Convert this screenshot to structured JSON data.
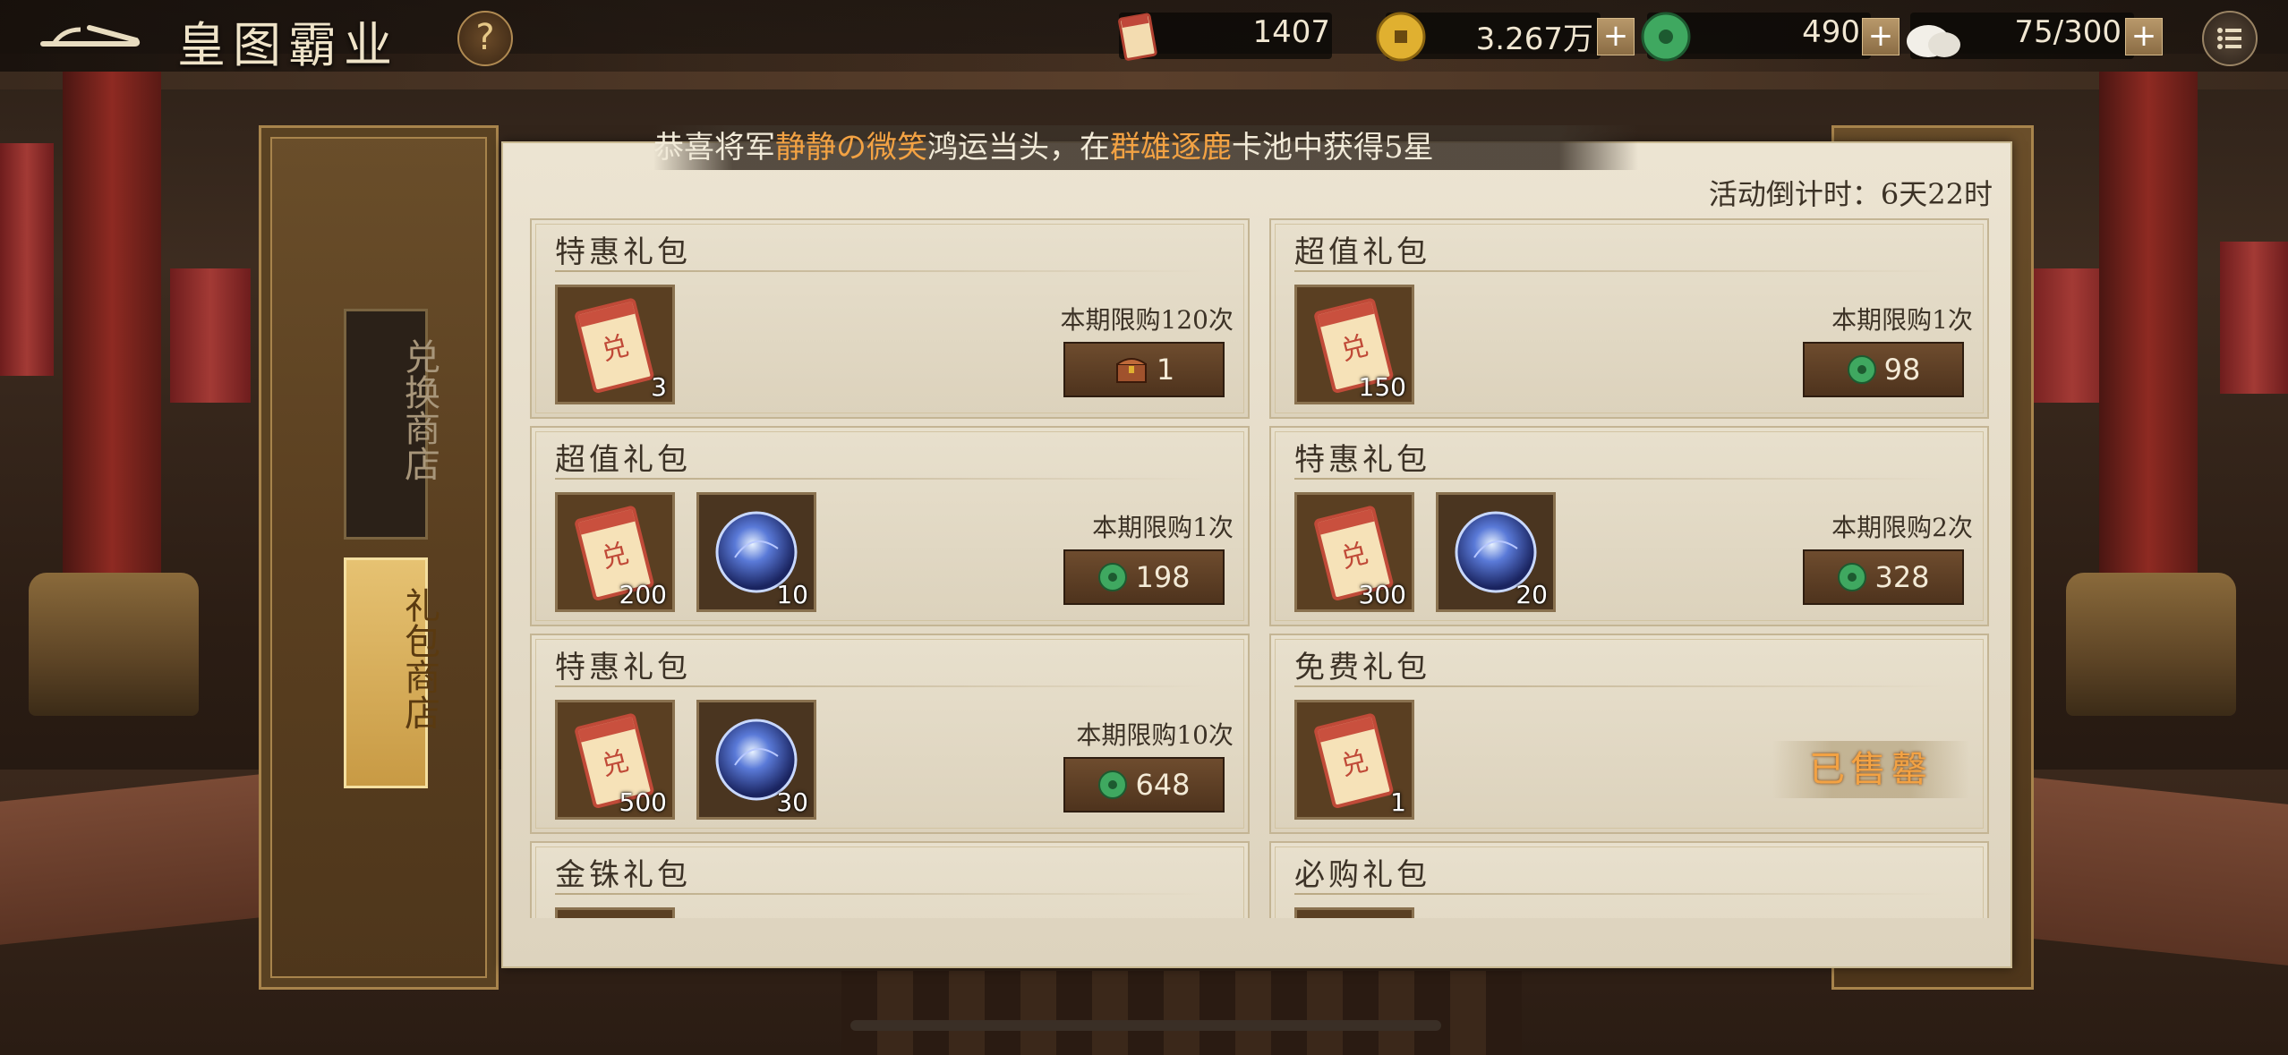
{
  "header": {
    "title": "皇图霸业",
    "help_label": "?"
  },
  "resources": {
    "tickets": "1407",
    "gold": "3.267万",
    "jade": "490",
    "stamina": "75/300",
    "plus_label": "+"
  },
  "tabs": [
    {
      "label": "兑换商店",
      "active": false
    },
    {
      "label": "礼包商店",
      "active": true
    }
  ],
  "marquee": {
    "prefix": "恭喜将军",
    "player": "静静の微笑",
    "middle": "鸿运当头，在",
    "pool": "群雄逐鹿",
    "suffix": "卡池中获得5星"
  },
  "countdown": "活动倒计时：6天22时",
  "packs": [
    {
      "title": "特惠礼包",
      "items": [
        {
          "icon": "exchange-ticket-icon",
          "count": "3"
        }
      ],
      "limit": "本期限购120次",
      "price_icon": "treasure-chest-icon",
      "price": "1"
    },
    {
      "title": "超值礼包",
      "items": [
        {
          "icon": "exchange-ticket-icon",
          "count": "150"
        }
      ],
      "limit": "本期限购1次",
      "price_icon": "jade-coin-icon",
      "price": "98"
    },
    {
      "title": "超值礼包",
      "items": [
        {
          "icon": "exchange-ticket-icon",
          "count": "200"
        },
        {
          "icon": "blue-orb-icon",
          "count": "10"
        }
      ],
      "limit": "本期限购1次",
      "price_icon": "jade-coin-icon",
      "price": "198"
    },
    {
      "title": "特惠礼包",
      "items": [
        {
          "icon": "exchange-ticket-icon",
          "count": "300"
        },
        {
          "icon": "blue-orb-icon",
          "count": "20"
        }
      ],
      "limit": "本期限购2次",
      "price_icon": "jade-coin-icon",
      "price": "328"
    },
    {
      "title": "特惠礼包",
      "items": [
        {
          "icon": "exchange-ticket-icon",
          "count": "500"
        },
        {
          "icon": "blue-orb-icon",
          "count": "30"
        }
      ],
      "limit": "本期限购10次",
      "price_icon": "jade-coin-icon",
      "price": "648"
    },
    {
      "title": "免费礼包",
      "items": [
        {
          "icon": "exchange-ticket-icon",
          "count": "1"
        }
      ],
      "status": "已售罄"
    },
    {
      "title": "金铢礼包",
      "items": [
        {
          "icon": "exchange-ticket-icon",
          "count": ""
        }
      ]
    },
    {
      "title": "必购礼包",
      "items": [
        {
          "icon": "exchange-ticket-icon",
          "count": ""
        }
      ]
    }
  ],
  "colors": {
    "accent_orange": "#f3a243",
    "panel_bg": "#e8e0cd",
    "frame_gold": "#a8844c"
  }
}
